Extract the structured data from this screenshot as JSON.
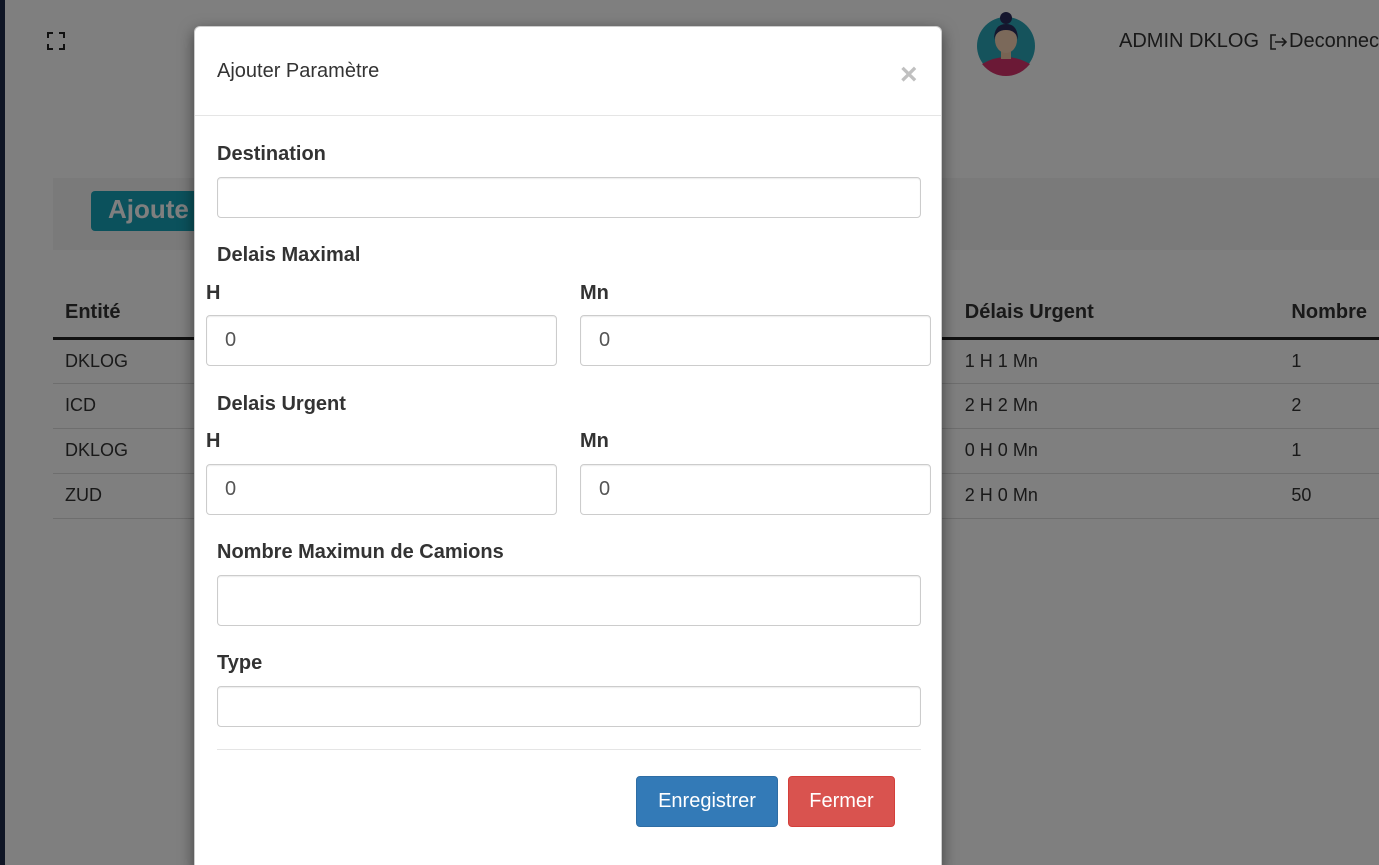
{
  "header": {
    "user_name": "ADMIN DKLOG",
    "logout_label": "Deconnec"
  },
  "toolbar": {
    "add_label": "Ajoute"
  },
  "table": {
    "columns": [
      "Entité",
      "Délais Urgent",
      "Nombre"
    ],
    "rows": [
      [
        "DKLOG",
        "1 H 1 Mn",
        "1"
      ],
      [
        "ICD",
        "2 H 2 Mn",
        "2"
      ],
      [
        "DKLOG",
        "0 H 0 Mn",
        "1"
      ],
      [
        "ZUD",
        "2 H 0 Mn",
        "50"
      ]
    ]
  },
  "modal": {
    "title": "Ajouter Paramètre",
    "close_symbol": "×",
    "destination": {
      "label": "Destination",
      "value": ""
    },
    "delais_maximal": {
      "label": "Delais Maximal",
      "hours": {
        "label": "H",
        "value": "0"
      },
      "minutes": {
        "label": "Mn",
        "value": "0"
      }
    },
    "delais_urgent": {
      "label": "Delais Urgent",
      "hours": {
        "label": "H",
        "value": "0"
      },
      "minutes": {
        "label": "Mn",
        "value": "0"
      }
    },
    "nombre_camions": {
      "label": "Nombre Maximun de Camions",
      "value": ""
    },
    "type": {
      "label": "Type",
      "value": ""
    },
    "save_label": "Enregistrer",
    "close_label": "Fermer"
  },
  "colors": {
    "save_button": "#337ab7",
    "close_button": "#d9534f",
    "add_button": "#17a2b8",
    "sidebar": "#1e2a4a"
  }
}
